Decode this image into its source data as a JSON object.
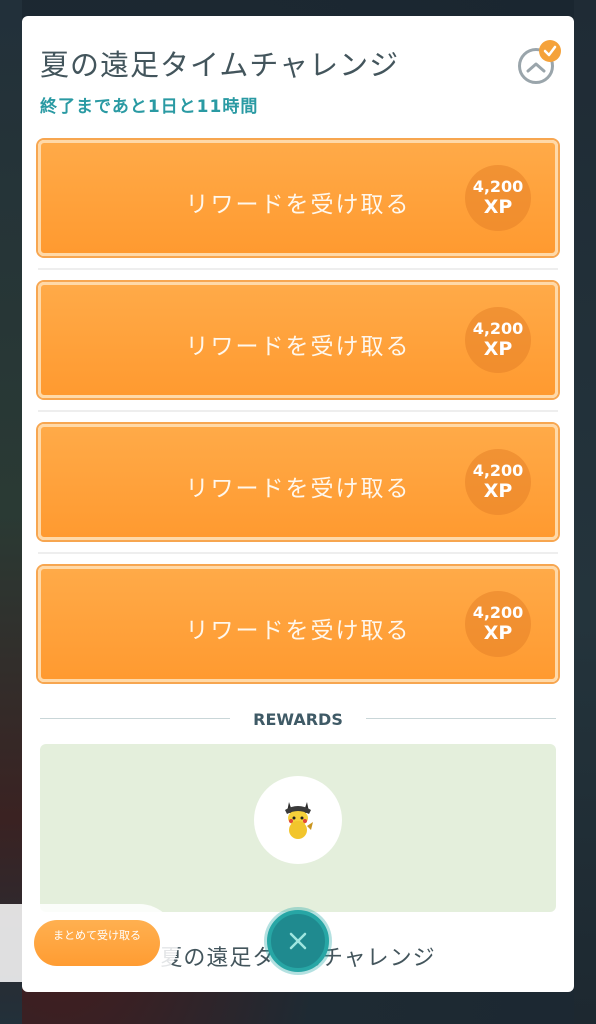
{
  "header": {
    "title": "夏の遠足タイムチャレンジ",
    "subtitle": "終了まであと1日と11時間"
  },
  "rewards_list": [
    {
      "label": "リワードを受け取る",
      "xp_amount": "4,200",
      "xp_unit": "XP"
    },
    {
      "label": "リワードを受け取る",
      "xp_amount": "4,200",
      "xp_unit": "XP"
    },
    {
      "label": "リワードを受け取る",
      "xp_amount": "4,200",
      "xp_unit": "XP"
    },
    {
      "label": "リワードを受け取る",
      "xp_amount": "4,200",
      "xp_unit": "XP"
    }
  ],
  "rewards_section": {
    "heading": "REWARDS",
    "item_icon": "pikachu-icon"
  },
  "footer": {
    "claim_all_label": "まとめて受け取る",
    "challenge_name": "夏の遠足タイムチャレンジ"
  },
  "icons": {
    "badge": "chevron-up-check-icon",
    "close": "close-icon"
  },
  "colors": {
    "accent_orange": "#ff9a30",
    "teal": "#1f8a8f",
    "subtitle_teal": "#2a9aa3",
    "rewards_bg": "#e4efdc"
  }
}
